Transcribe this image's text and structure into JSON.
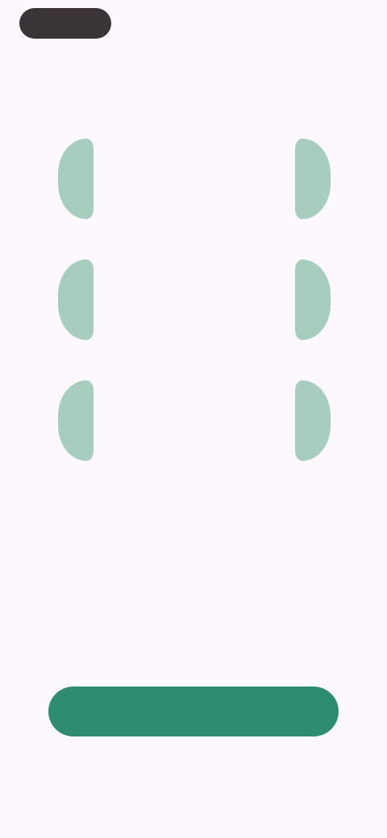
{
  "header": {
    "skip_label": ""
  },
  "cards": [
    {
      "value": "",
      "caption": ""
    },
    {
      "value": "",
      "caption": ""
    },
    {
      "value": "",
      "caption": ""
    }
  ],
  "headline": "",
  "subtext": "",
  "cta_label": "",
  "colors": {
    "background": "#fdf8fd",
    "accent": "#2e8c73",
    "leaf": "#a6cdbd",
    "pill": "#3a3338"
  },
  "icons": {
    "card_decoration": "laurel-leaf-icon"
  }
}
